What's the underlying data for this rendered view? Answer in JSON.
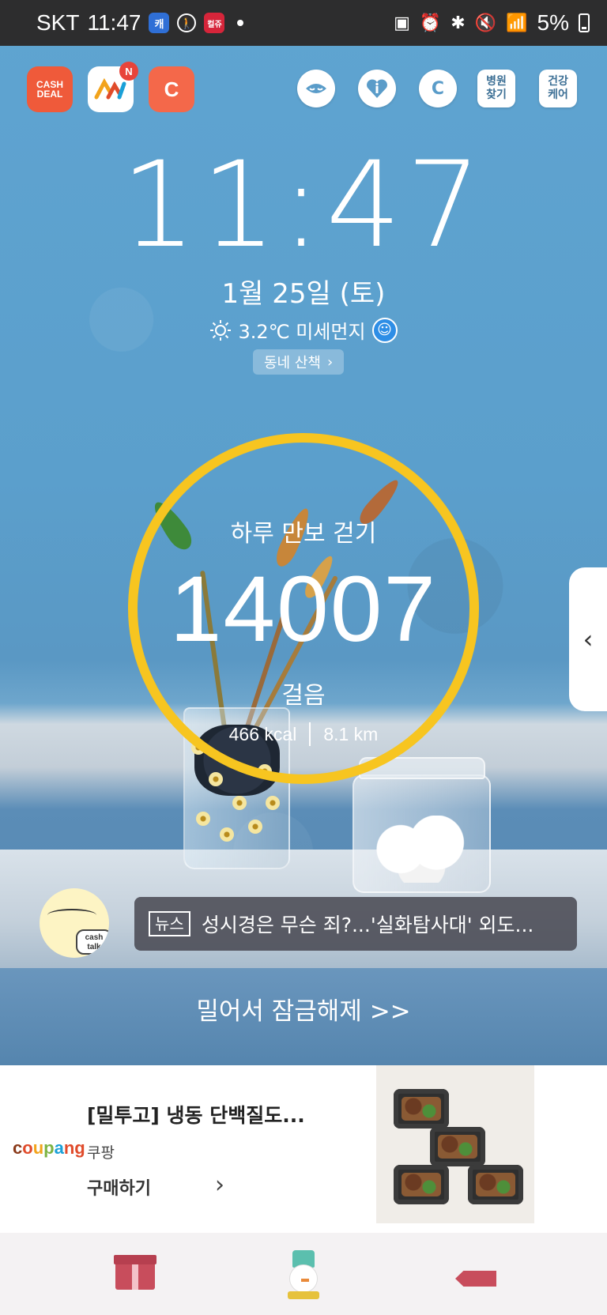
{
  "status_bar": {
    "carrier": "SKT",
    "time": "11:47",
    "app_icons": [
      "cashwalk-s-icon",
      "walking-icon",
      "event-app-icon"
    ],
    "app_icon_labels": [
      "캐",
      "",
      "컬쥬"
    ],
    "battery": "5%"
  },
  "shortcuts": {
    "cashdeal_line1": "CASH",
    "cashdeal_line2": "DEAL",
    "news_badge": "N",
    "cashwalk_label": "C",
    "coin_label": "C",
    "hospital_label_1": "병원",
    "hospital_label_2": "찾기",
    "health_label_1": "건강",
    "health_label_2": "케어"
  },
  "lock": {
    "clock": "11:47",
    "date": "1월 25일 (토)",
    "weather": "3.2℃ 미세먼지",
    "walk_chip": "동네 산책"
  },
  "steps": {
    "title": "하루 만보 걷기",
    "count": "14007",
    "unit": "걸음",
    "kcal": "466 kcal",
    "distance": "8.1 km",
    "ring_color": "#f7c520"
  },
  "cashtalk": {
    "label_line1": "cash",
    "label_line2": "talk"
  },
  "news": {
    "tag": "뉴스",
    "headline": "성시경은 무슨 죄?...'실화탐사대' 외도..."
  },
  "unlock": {
    "label": "밀어서 잠금해제 >>"
  },
  "ad": {
    "brand": [
      "c",
      "o",
      "u",
      "p",
      "a",
      "ng"
    ],
    "title": "[밀투고] 냉동 단백질도...",
    "seller": "쿠팡",
    "cta": "구매하기"
  },
  "colors": {
    "status_bar": "#2d2d2e",
    "accent": "#f7c520",
    "bottom_nav_accent": "#c84d5c"
  }
}
